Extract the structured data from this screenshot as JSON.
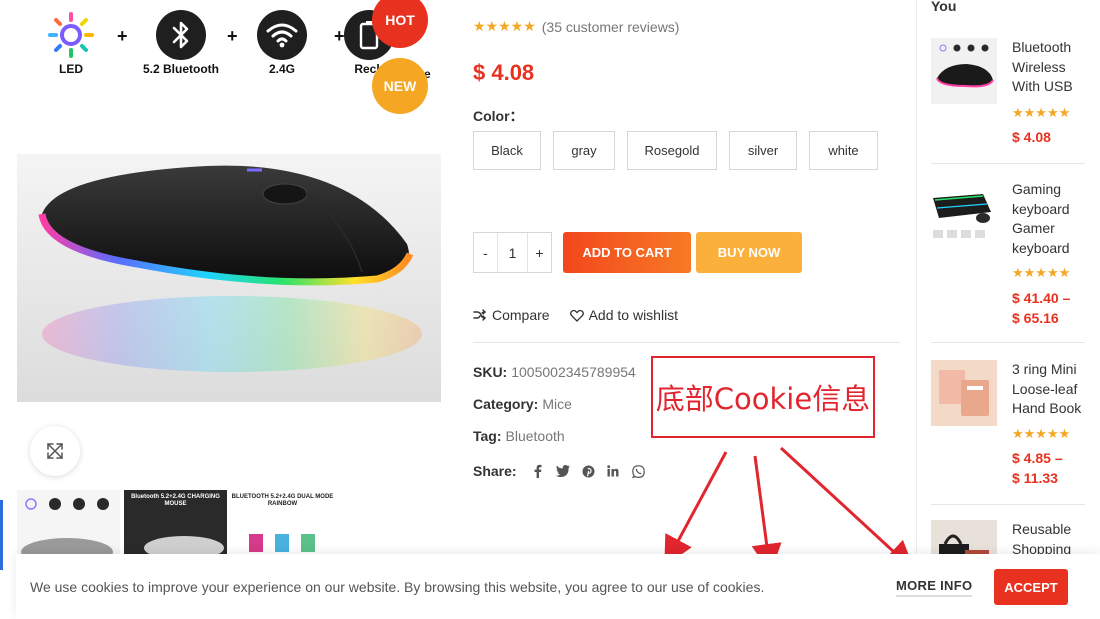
{
  "product": {
    "features": [
      {
        "label": "LED",
        "icon": "led-light-icon"
      },
      {
        "label": "5.2 Bluetooth",
        "icon": "bluetooth-icon"
      },
      {
        "label": "2.4G",
        "icon": "wifi-icon"
      },
      {
        "label": "Rech",
        "icon": "battery-icon"
      },
      {
        "label": "e",
        "icon": ""
      }
    ],
    "badges": {
      "hot": "HOT",
      "new": "NEW"
    },
    "thumbnails": [
      {
        "caption": ""
      },
      {
        "caption": "Bluetooth 5.2+2.4G CHARGING MOUSE"
      },
      {
        "caption": "BLUETOOTH 5.2+2.4G DUAL MODE RAINBOW"
      }
    ],
    "rating_stars": "★★★★★",
    "reviews": "(35 customer reviews)",
    "price": "$ 4.08",
    "color_label": "Color：",
    "colors": [
      "Black",
      "gray",
      "Rosegold",
      "silver",
      "white"
    ],
    "quantity": {
      "minus": "-",
      "value": "1",
      "plus": "+"
    },
    "add_to_cart": "ADD TO CART",
    "buy_now": "BUY NOW",
    "compare": "Compare",
    "wishlist": "Add to wishlist",
    "sku": {
      "label": "SKU:",
      "value": "1005002345789954"
    },
    "category": {
      "label": "Category:",
      "value": "Mice"
    },
    "tag": {
      "label": "Tag:",
      "value": "Bluetooth"
    },
    "share_label": "Share:",
    "share_icons": [
      "facebook-icon",
      "twitter-icon",
      "pinterest-icon",
      "linkedin-icon",
      "whatsapp-icon"
    ]
  },
  "annotation": {
    "text": "底部Cookie信息",
    "color": "#e2262f"
  },
  "sidebar": {
    "title": "You",
    "items": [
      {
        "name": "Bluetooth Wireless With USB",
        "stars": "★★★★★",
        "price": "$ 4.08"
      },
      {
        "name": "Gaming keyboard Gamer keyboard",
        "stars": "★★★★★",
        "price": "$ 41.40 –",
        "price2": "$ 65.16"
      },
      {
        "name": "3 ring Mini Loose-leaf Hand Book",
        "stars": "★★★★★",
        "price": "$ 4.85 –",
        "price2": "$ 11.33"
      },
      {
        "name": "Reusable Shopping"
      }
    ]
  },
  "cookie": {
    "text": "We use cookies to improve your experience on our website. By browsing this website, you agree to our use of cookies.",
    "more_info": "MORE INFO",
    "accept": "ACCEPT"
  },
  "colors": {
    "accent_red": "#e8311f",
    "orange": "#fbb03b",
    "star": "#f5a623"
  }
}
